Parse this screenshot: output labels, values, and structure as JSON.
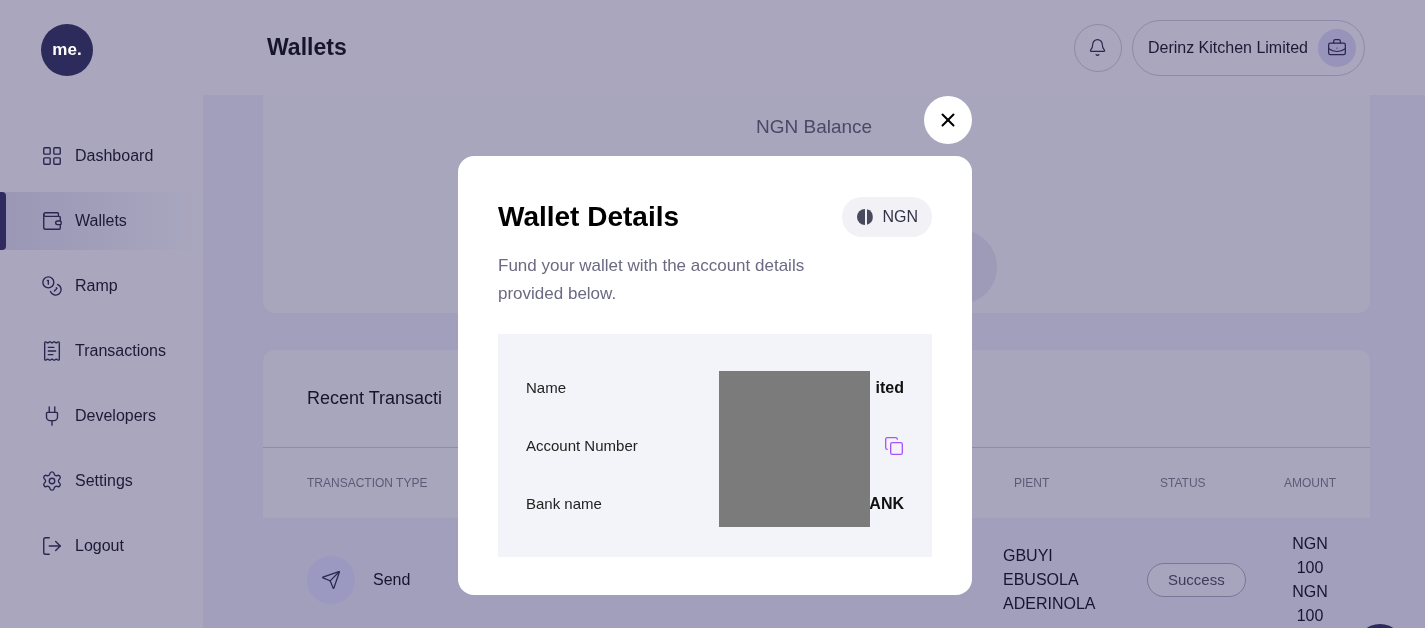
{
  "header": {
    "title": "Wallets",
    "account_name": "Derinz Kitchen Limited"
  },
  "logo": {
    "text": "me."
  },
  "sidebar": {
    "items": [
      {
        "label": "Dashboard",
        "selected": false
      },
      {
        "label": "Wallets",
        "selected": true
      },
      {
        "label": "Ramp",
        "selected": false
      },
      {
        "label": "Transactions",
        "selected": false
      },
      {
        "label": "Developers",
        "selected": false
      },
      {
        "label": "Settings",
        "selected": false
      },
      {
        "label": "Logout",
        "selected": false
      }
    ]
  },
  "balance_card": {
    "label": "NGN Balance"
  },
  "recent_transactions": {
    "title": "Recent Transacti",
    "columns": [
      "TRANSACTION TYPE",
      "PIENT",
      "STATUS",
      "AMOUNT"
    ],
    "rows": [
      {
        "type": "Send",
        "recipient": [
          "GBUYI",
          "EBUSOLA",
          "ADERINOLA"
        ],
        "status": "Success",
        "amount": [
          "NGN",
          "100",
          "NGN",
          "100"
        ]
      }
    ]
  },
  "modal": {
    "title": "Wallet Details",
    "currency": "NGN",
    "description": "Fund your wallet with the account details provided below.",
    "details": [
      {
        "label": "Name",
        "value": "ited",
        "kind": "text"
      },
      {
        "label": "Account Number",
        "kind": "copy"
      },
      {
        "label": "Bank name",
        "value": "ANK",
        "kind": "text"
      }
    ]
  }
}
